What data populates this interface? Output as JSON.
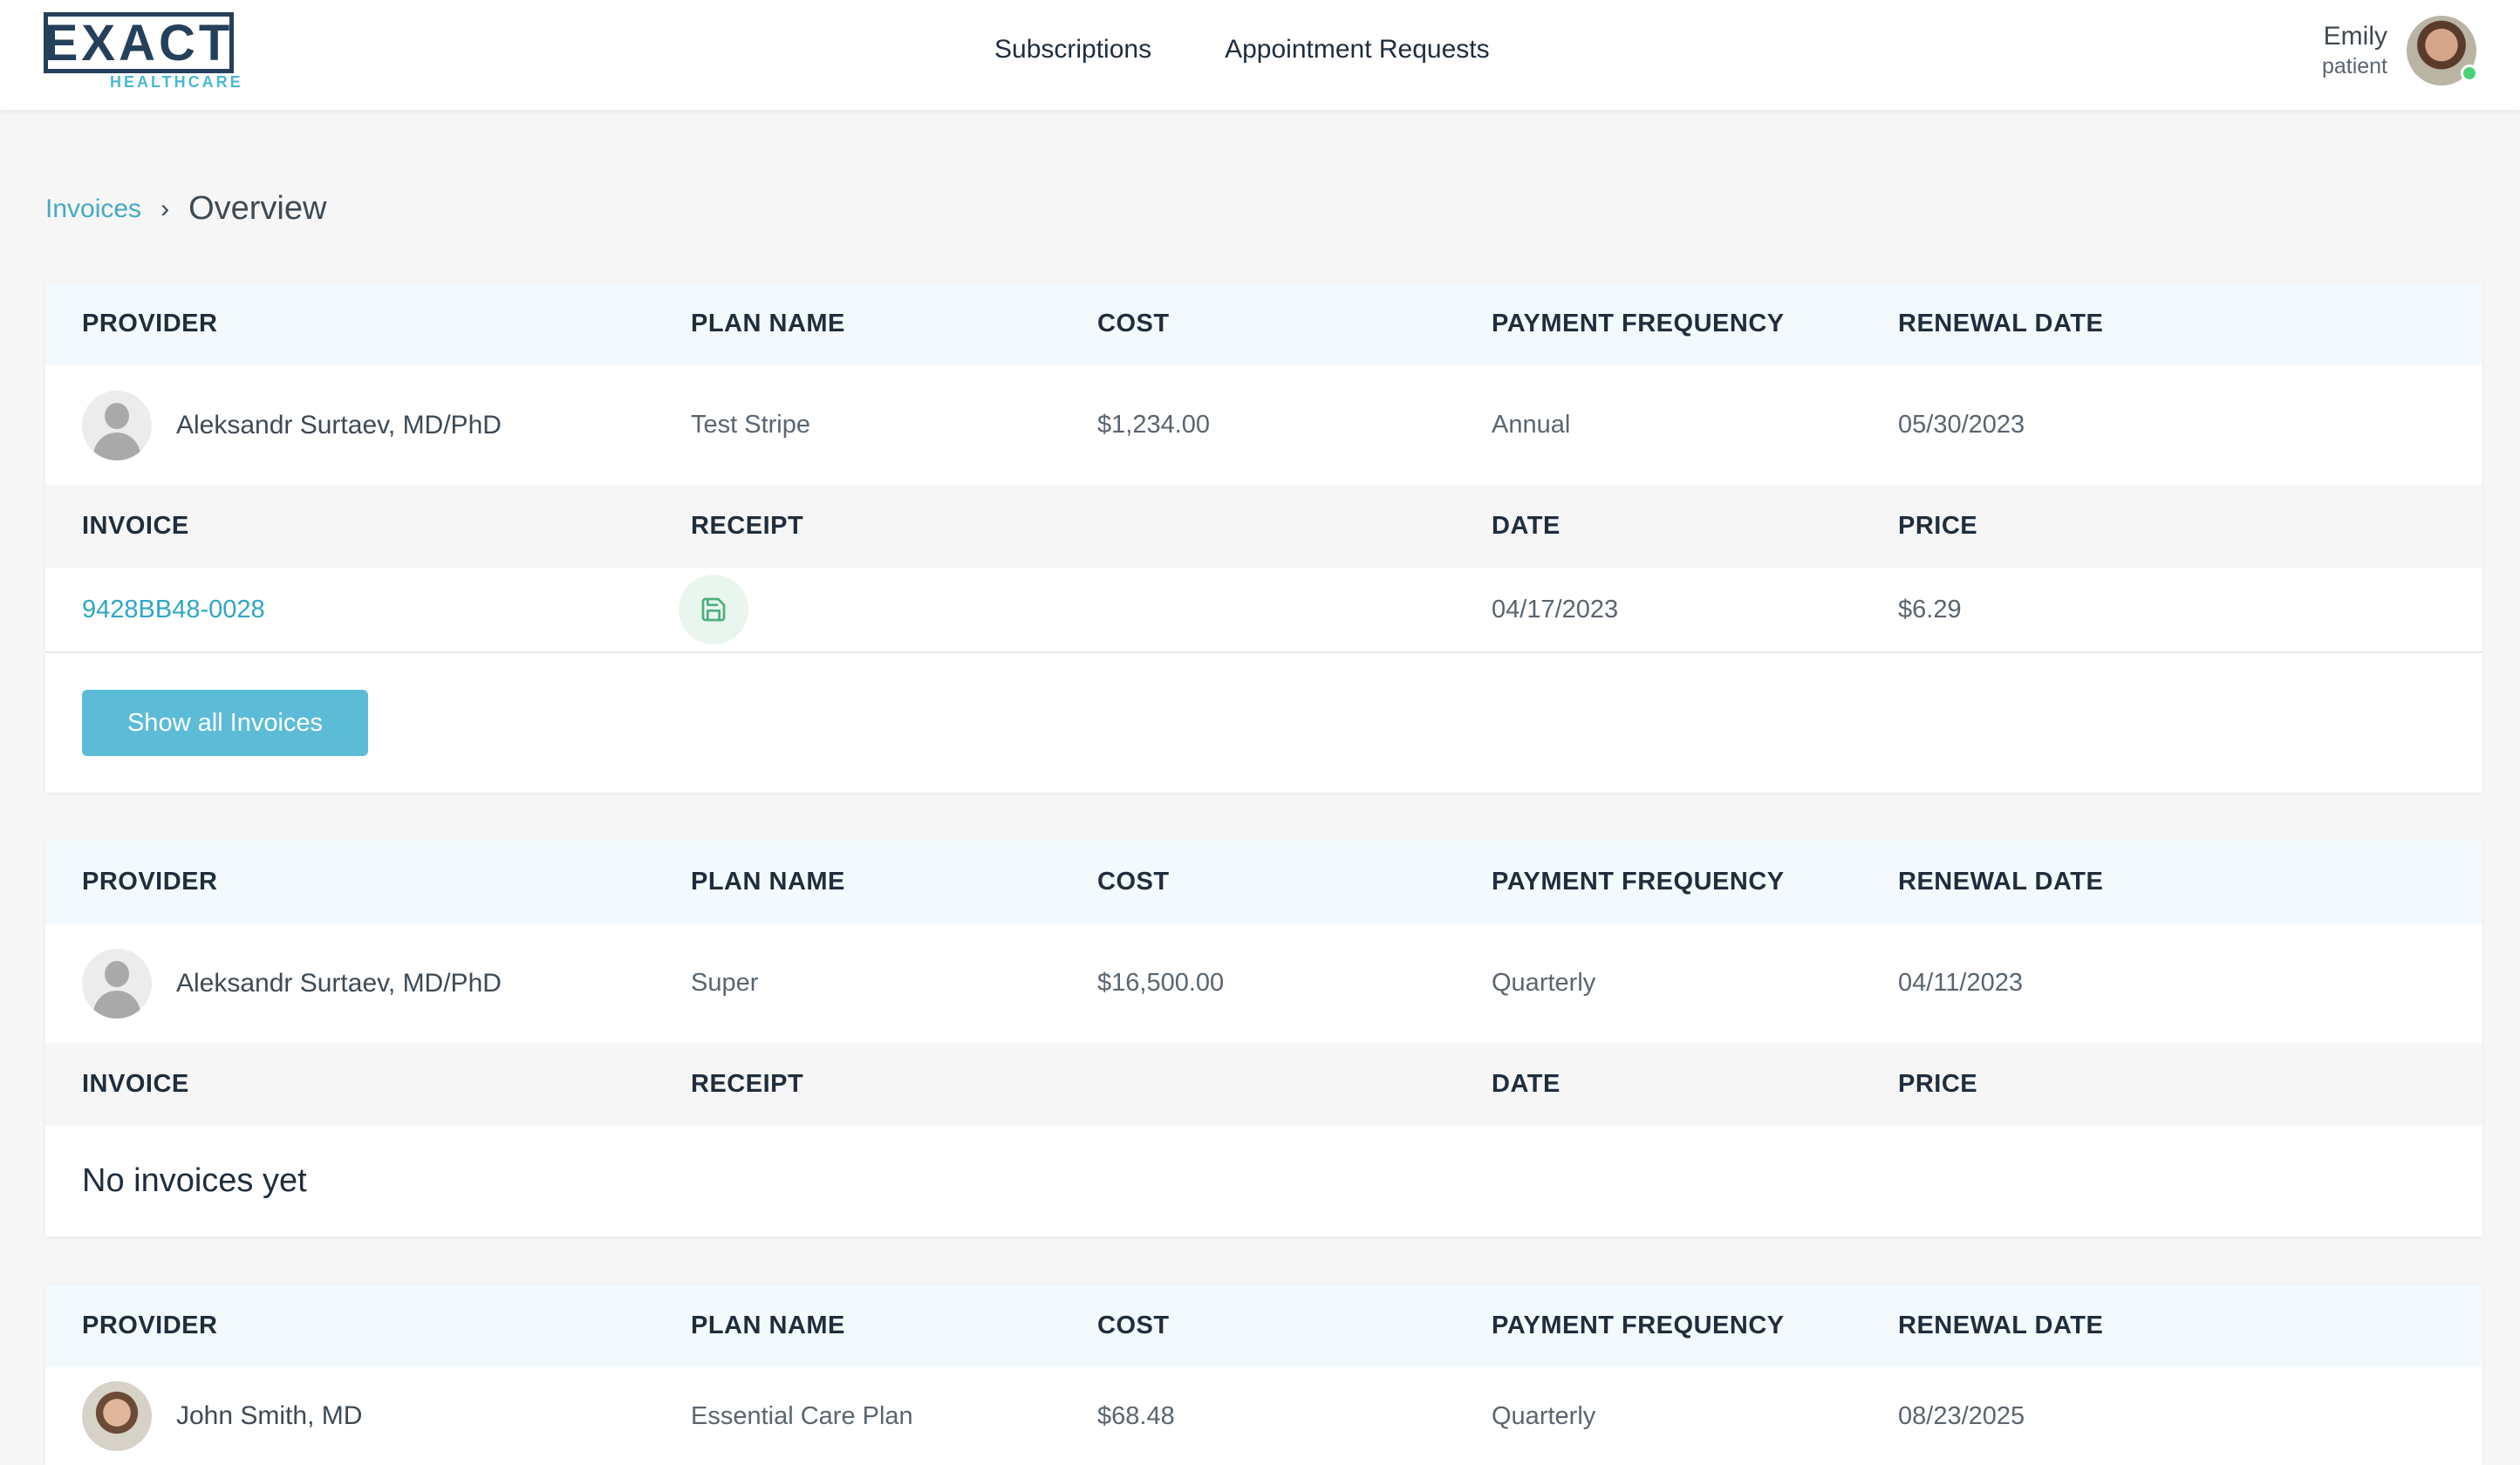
{
  "header": {
    "logo_main": "EXACT",
    "logo_sub": "HEALTHCARE",
    "nav": [
      "Subscriptions",
      "Appointment Requests"
    ],
    "user": {
      "name": "Emily",
      "role": "patient"
    }
  },
  "breadcrumb": {
    "parent": "Invoices",
    "current": "Overview"
  },
  "subscription_headers": [
    "PROVIDER",
    "PLAN NAME",
    "COST",
    "PAYMENT FREQUENCY",
    "RENEWAL DATE"
  ],
  "invoice_headers": [
    "INVOICE",
    "RECEIPT",
    "DATE",
    "PRICE"
  ],
  "subscriptions": [
    {
      "provider": "Aleksandr Surtaev, MD/PhD",
      "plan": "Test Stripe",
      "cost": "$1,234.00",
      "frequency": "Annual",
      "renewal": "05/30/2023",
      "invoice": {
        "id": "9428BB48-0028",
        "date": "04/17/2023",
        "price": "$6.29"
      },
      "button": "Show all Invoices"
    },
    {
      "provider": "Aleksandr Surtaev, MD/PhD",
      "plan": "Super",
      "cost": "$16,500.00",
      "frequency": "Quarterly",
      "renewal": "04/11/2023",
      "empty": "No invoices yet"
    },
    {
      "provider": "John Smith, MD",
      "plan": "Essential Care Plan",
      "cost": "$68.48",
      "frequency": "Quarterly",
      "renewal": "08/23/2025"
    }
  ],
  "icons": {
    "receipt": "save-icon",
    "receipt_color": "#4caf7a"
  }
}
